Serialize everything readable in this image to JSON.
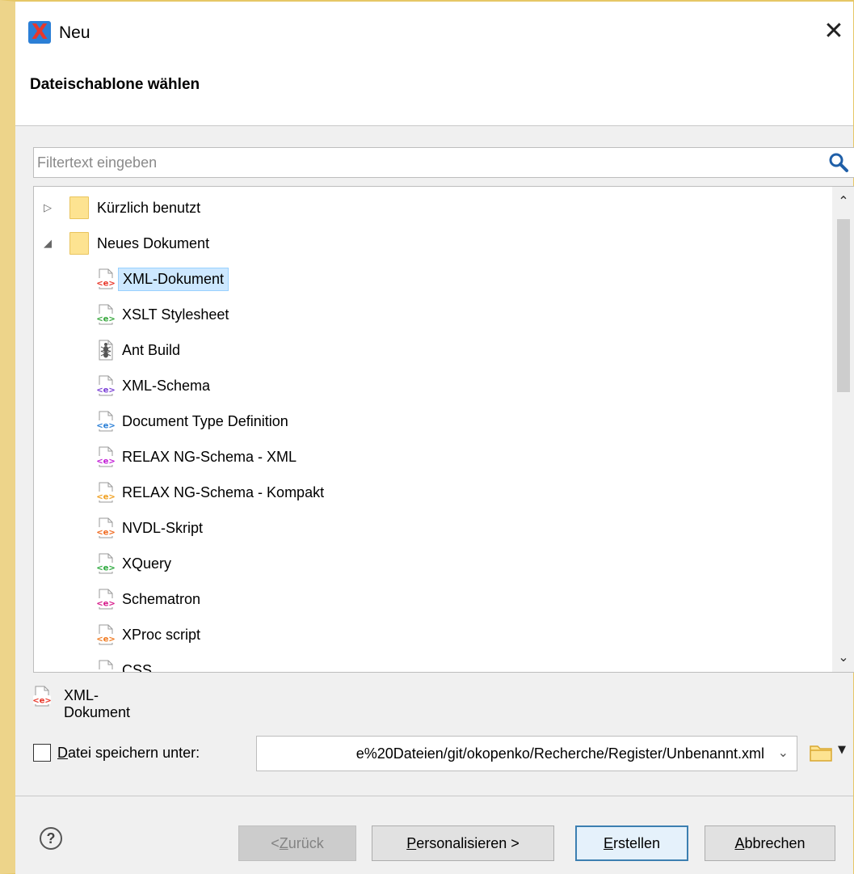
{
  "window": {
    "title": "Neu",
    "close_icon": "close-icon"
  },
  "header": {
    "title": "Dateischablone wählen"
  },
  "filter": {
    "placeholder": "Filtertext eingeben",
    "value": ""
  },
  "tree": {
    "folders": [
      {
        "label": "Kürzlich benutzt",
        "expanded": false
      },
      {
        "label": "Neues Dokument",
        "expanded": true
      }
    ],
    "items": [
      {
        "label": "XML-Dokument",
        "icon": "xml-document-icon",
        "color": "#e8372a",
        "selected": true
      },
      {
        "label": "XSLT Stylesheet",
        "icon": "xslt-icon",
        "color": "#35a63b",
        "selected": false
      },
      {
        "label": "Ant Build",
        "icon": "ant-icon",
        "color": "#555555",
        "selected": false
      },
      {
        "label": "XML-Schema",
        "icon": "xml-schema-icon",
        "color": "#7a3fd6",
        "selected": false
      },
      {
        "label": "Document Type Definition",
        "icon": "dtd-icon",
        "color": "#2a7fd6",
        "selected": false
      },
      {
        "label": "RELAX NG-Schema - XML",
        "icon": "relaxng-xml-icon",
        "color": "#c21bd6",
        "selected": false
      },
      {
        "label": "RELAX NG-Schema - Kompakt",
        "icon": "relaxng-compact-icon",
        "color": "#f0a020",
        "selected": false
      },
      {
        "label": "NVDL-Skript",
        "icon": "nvdl-icon",
        "color": "#f06a20",
        "selected": false
      },
      {
        "label": "XQuery",
        "icon": "xquery-icon",
        "color": "#2aa83b",
        "selected": false
      },
      {
        "label": "Schematron",
        "icon": "schematron-icon",
        "color": "#d61b8a",
        "selected": false
      },
      {
        "label": "XProc script",
        "icon": "xproc-icon",
        "color": "#f07a20",
        "selected": false
      },
      {
        "label": "CSS",
        "icon": "css-icon",
        "color": "#2aa83b",
        "selected": false
      }
    ]
  },
  "preview": {
    "label": "XML-Dokument",
    "icon": "xml-document-icon"
  },
  "save": {
    "checked": false,
    "label_mnemonic": "D",
    "label_rest": "atei speichern unter:",
    "path": "e%20Dateien/git/okopenko/Recherche/Register/Unbenannt.xml"
  },
  "footer": {
    "help": "?",
    "back": {
      "prefix": "< ",
      "mnemonic": "Z",
      "rest": "urück"
    },
    "personalize": {
      "mnemonic": "P",
      "rest": "ersonalisieren >"
    },
    "create": {
      "mnemonic": "E",
      "rest": "rstellen"
    },
    "cancel": {
      "mnemonic": "A",
      "rest": "bbrechen"
    }
  }
}
